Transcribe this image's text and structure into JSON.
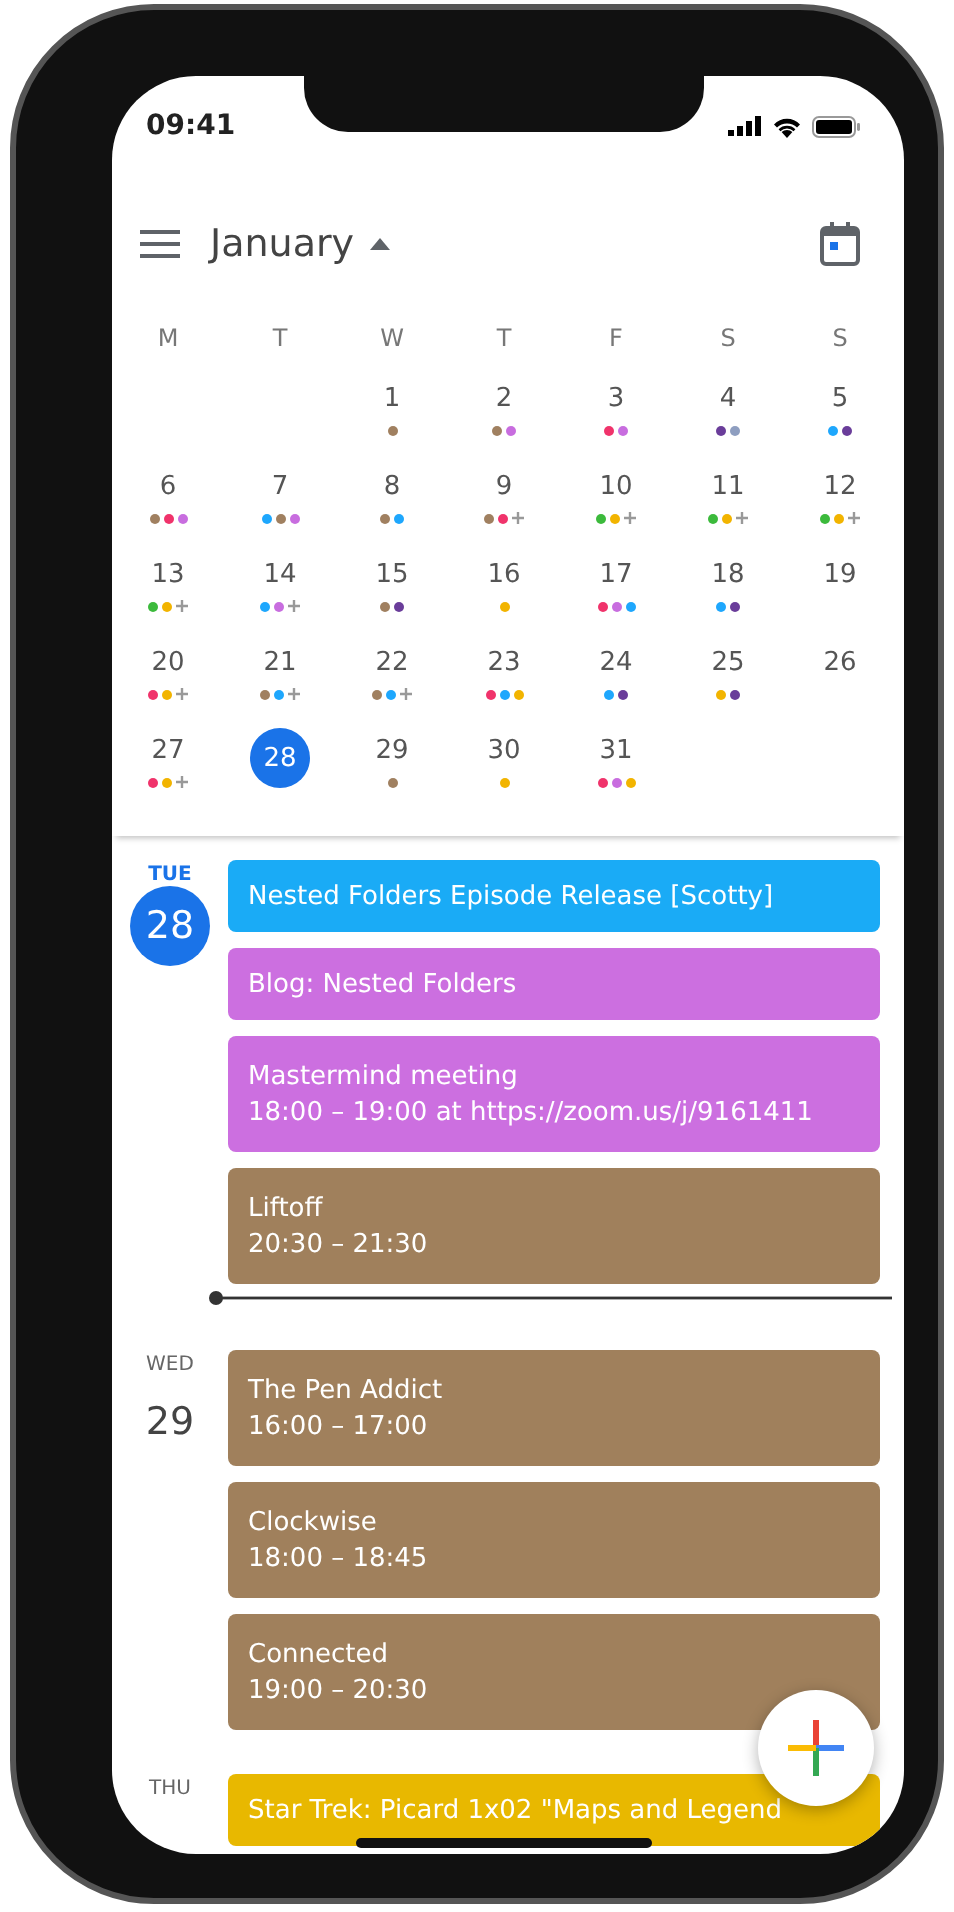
{
  "status_bar": {
    "time": "09:41"
  },
  "header": {
    "month": "January"
  },
  "weekdays": [
    "M",
    "T",
    "W",
    "T",
    "F",
    "S",
    "S"
  ],
  "weeks": [
    {
      "days": [
        {
          "date": "1",
          "selected": false,
          "dots": [
            {
              "color": "#a08060"
            }
          ],
          "more": false
        },
        {
          "date": "2",
          "selected": false,
          "dots": [
            {
              "color": "#a08060"
            },
            {
              "color": "#c86ddf"
            }
          ],
          "more": false
        },
        {
          "date": "3",
          "selected": false,
          "dots": [
            {
              "color": "#f0336b"
            },
            {
              "color": "#c86ddf"
            }
          ],
          "more": false
        },
        {
          "date": "4",
          "selected": false,
          "dots": [
            {
              "color": "#6a3d9a"
            },
            {
              "color": "#8e9ec0"
            }
          ],
          "more": false
        },
        {
          "date": "5",
          "selected": false,
          "dots": [
            {
              "color": "#1ea7fd"
            },
            {
              "color": "#6a3d9a"
            }
          ],
          "more": false
        }
      ]
    },
    {
      "days": [
        {
          "date": "6",
          "selected": false,
          "dots": [
            {
              "color": "#a08060"
            },
            {
              "color": "#f0336b"
            },
            {
              "color": "#c86ddf"
            }
          ],
          "more": false
        },
        {
          "date": "7",
          "selected": false,
          "dots": [
            {
              "color": "#1ea7fd"
            },
            {
              "color": "#a08060"
            },
            {
              "color": "#c86ddf"
            }
          ],
          "more": false
        },
        {
          "date": "8",
          "selected": false,
          "dots": [
            {
              "color": "#a08060"
            },
            {
              "color": "#1ea7fd"
            }
          ],
          "more": false
        },
        {
          "date": "9",
          "selected": false,
          "dots": [
            {
              "color": "#a08060"
            },
            {
              "color": "#f0336b"
            }
          ],
          "more": true
        },
        {
          "date": "10",
          "selected": false,
          "dots": [
            {
              "color": "#3cba3c"
            },
            {
              "color": "#f2b400"
            }
          ],
          "more": true
        },
        {
          "date": "11",
          "selected": false,
          "dots": [
            {
              "color": "#3cba3c"
            },
            {
              "color": "#f2b400"
            }
          ],
          "more": true
        },
        {
          "date": "12",
          "selected": false,
          "dots": [
            {
              "color": "#3cba3c"
            },
            {
              "color": "#f2b400"
            }
          ],
          "more": true
        }
      ]
    },
    {
      "days": [
        {
          "date": "13",
          "selected": false,
          "dots": [
            {
              "color": "#3cba3c"
            },
            {
              "color": "#f2b400"
            }
          ],
          "more": true
        },
        {
          "date": "14",
          "selected": false,
          "dots": [
            {
              "color": "#1ea7fd"
            },
            {
              "color": "#c86ddf"
            }
          ],
          "more": true
        },
        {
          "date": "15",
          "selected": false,
          "dots": [
            {
              "color": "#a08060"
            },
            {
              "color": "#6a3d9a"
            }
          ],
          "more": false
        },
        {
          "date": "16",
          "selected": false,
          "dots": [
            {
              "color": "#f2b400"
            }
          ],
          "more": false
        },
        {
          "date": "17",
          "selected": false,
          "dots": [
            {
              "color": "#f0336b"
            },
            {
              "color": "#c86ddf"
            },
            {
              "color": "#1ea7fd"
            }
          ],
          "more": false
        },
        {
          "date": "18",
          "selected": false,
          "dots": [
            {
              "color": "#1ea7fd"
            },
            {
              "color": "#6a3d9a"
            }
          ],
          "more": false
        },
        {
          "date": "19",
          "selected": false,
          "more": false
        }
      ]
    },
    {
      "days": [
        {
          "date": "20",
          "selected": false,
          "dots": [
            {
              "color": "#f0336b"
            },
            {
              "color": "#f2b400"
            }
          ],
          "more": true
        },
        {
          "date": "21",
          "selected": false,
          "dots": [
            {
              "color": "#a08060"
            },
            {
              "color": "#1ea7fd"
            }
          ],
          "more": true
        },
        {
          "date": "22",
          "selected": false,
          "dots": [
            {
              "color": "#a08060"
            },
            {
              "color": "#1ea7fd"
            }
          ],
          "more": true
        },
        {
          "date": "23",
          "selected": false,
          "dots": [
            {
              "color": "#f0336b"
            },
            {
              "color": "#1ea7fd"
            },
            {
              "color": "#f2b400"
            }
          ],
          "more": false
        },
        {
          "date": "24",
          "selected": false,
          "dots": [
            {
              "color": "#1ea7fd"
            },
            {
              "color": "#6a3d9a"
            }
          ],
          "more": false
        },
        {
          "date": "25",
          "selected": false,
          "dots": [
            {
              "color": "#f2b400"
            },
            {
              "color": "#6a3d9a"
            }
          ],
          "more": false
        },
        {
          "date": "26",
          "selected": false,
          "more": false
        }
      ]
    },
    {
      "days": [
        {
          "date": "27",
          "selected": false,
          "dots": [
            {
              "color": "#f0336b"
            },
            {
              "color": "#f2b400"
            }
          ],
          "more": true
        },
        {
          "date": "28",
          "selected": true,
          "more": false
        },
        {
          "date": "29",
          "selected": false,
          "dots": [
            {
              "color": "#a08060"
            }
          ],
          "more": false
        },
        {
          "date": "30",
          "selected": false,
          "dots": [
            {
              "color": "#f2b400"
            }
          ],
          "more": false
        },
        {
          "date": "31",
          "selected": false,
          "dots": [
            {
              "color": "#f0336b"
            },
            {
              "color": "#c86ddf"
            },
            {
              "color": "#f2b400"
            }
          ],
          "more": false
        }
      ]
    }
  ],
  "agenda": [
    {
      "weekday": "TUE",
      "date": "28",
      "today": true,
      "items": [
        {
          "kind": "event",
          "title": "Nested Folders Episode Release [Scotty]",
          "color": "#1aabf6"
        },
        {
          "kind": "event",
          "title": "Blog: Nested Folders",
          "color": "#cc6fe0"
        },
        {
          "kind": "event",
          "title": "Mastermind meeting",
          "time": "18:00 – 19:00 at https://zoom.us/j/9161411",
          "color": "#cc6fe0"
        },
        {
          "kind": "event",
          "title": "Liftoff",
          "time": "20:30 – 21:30",
          "color": "#a0805c"
        },
        {
          "kind": "now"
        }
      ]
    },
    {
      "weekday": "WED",
      "date": "29",
      "today": false,
      "items": [
        {
          "kind": "event",
          "title": "The Pen Addict",
          "time": "16:00 – 17:00",
          "color": "#a0805c"
        },
        {
          "kind": "event",
          "title": "Clockwise",
          "time": "18:00 – 18:45",
          "color": "#a0805c"
        },
        {
          "kind": "event",
          "title": "Connected",
          "time": "19:00 – 20:30",
          "color": "#a0805c"
        }
      ]
    },
    {
      "weekday": "THU",
      "today": false,
      "items": [
        {
          "kind": "event",
          "title": "Star Trek: Picard 1x02 \"Maps and Legend",
          "color": "#e8b800"
        }
      ]
    }
  ]
}
